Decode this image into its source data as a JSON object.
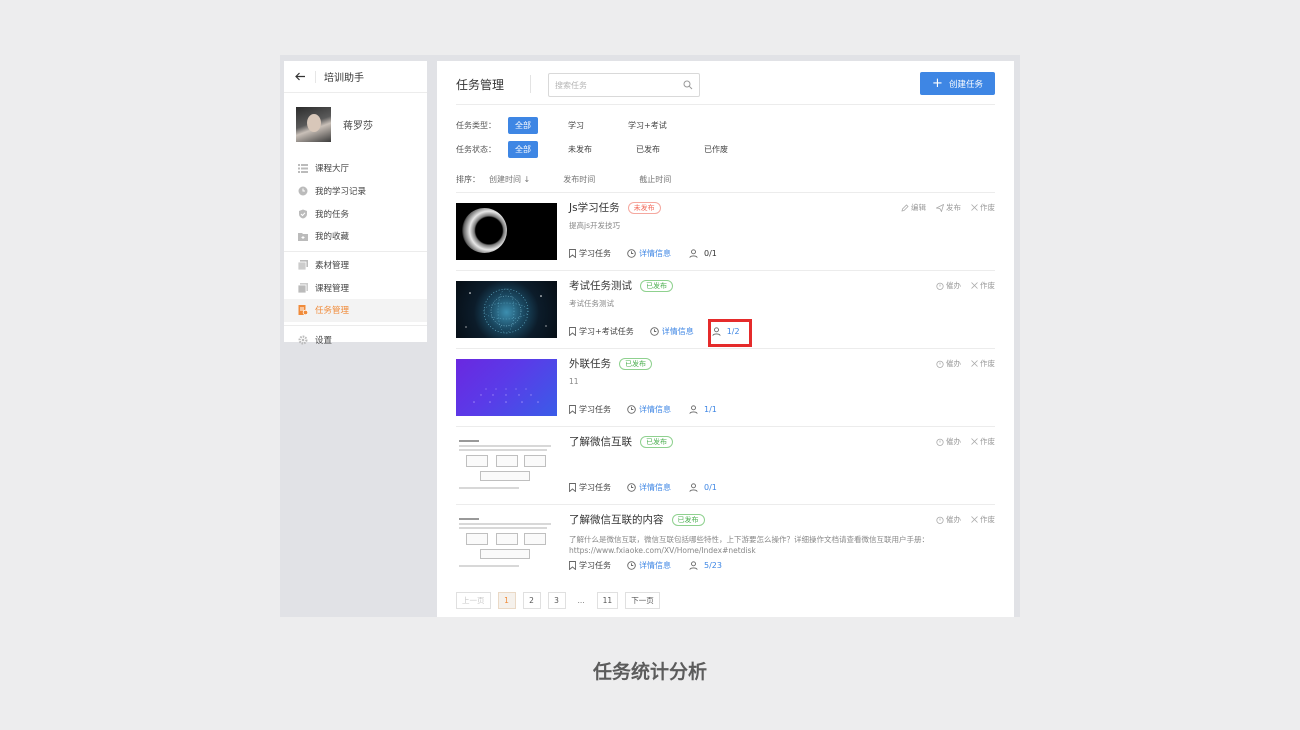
{
  "sidebar": {
    "app_title": "培训助手",
    "user_name": "蒋罗莎",
    "groups": [
      [
        {
          "label": "课程大厅",
          "icon": "list-icon"
        },
        {
          "label": "我的学习记录",
          "icon": "clock-icon"
        },
        {
          "label": "我的任务",
          "icon": "shield-check-icon"
        },
        {
          "label": "我的收藏",
          "icon": "folder-icon"
        }
      ],
      [
        {
          "label": "素材管理",
          "icon": "images-icon"
        },
        {
          "label": "课程管理",
          "icon": "pages-icon"
        },
        {
          "label": "任务管理",
          "icon": "task-doc-icon",
          "active": true
        }
      ],
      [
        {
          "label": "设置",
          "icon": "gear-icon"
        }
      ]
    ]
  },
  "header": {
    "title": "任务管理",
    "search_placeholder": "搜索任务",
    "create_label": "创建任务"
  },
  "filters": {
    "type_label": "任务类型：",
    "type_options": [
      "全部",
      "学习",
      "学习+考试"
    ],
    "type_selected": "全部",
    "status_label": "任务状态：",
    "status_options": [
      "全部",
      "未发布",
      "已发布",
      "已作废"
    ],
    "status_selected": "全部"
  },
  "sort": {
    "label": "排序：",
    "options": [
      "创建时间",
      "发布时间",
      "截止时间"
    ],
    "active": "创建时间"
  },
  "tasks": [
    {
      "name": "Js学习任务",
      "status": "未发布",
      "desc": "提高js开发技巧",
      "type": "学习任务",
      "detail": "详情信息",
      "count": "0/1",
      "actions": [
        "编辑",
        "发布",
        "作废"
      ]
    },
    {
      "name": "考试任务测试",
      "status": "已发布",
      "desc": "考试任务测试",
      "type": "学习+考试任务",
      "detail": "详情信息",
      "count": "1/2",
      "actions": [
        "催办",
        "作废"
      ]
    },
    {
      "name": "外联任务",
      "status": "已发布",
      "desc": "11",
      "type": "学习任务",
      "detail": "详情信息",
      "count": "1/1",
      "actions": [
        "催办",
        "作废"
      ]
    },
    {
      "name": "了解微信互联",
      "status": "已发布",
      "desc": "",
      "type": "学习任务",
      "detail": "详情信息",
      "count": "0/1",
      "actions": [
        "催办",
        "作废"
      ]
    },
    {
      "name": "了解微信互联的内容",
      "status": "已发布",
      "desc": "了解什么是微信互联，微信互联包括哪些特性，上下游要怎么操作？详细操作文档请查看微信互联用户手册：https://www.fxiaoke.com/XV/Home/Index#netdisk",
      "type": "学习任务",
      "detail": "详情信息",
      "count": "5/23",
      "actions": [
        "催办",
        "作废"
      ]
    }
  ],
  "pagination": {
    "prev": "上一页",
    "pages": [
      "1",
      "2",
      "3"
    ],
    "ellipsis": "...",
    "last": "11",
    "next": "下一页",
    "current": "1"
  },
  "caption": "任务统计分析",
  "colors": {
    "accent": "#3e86e4",
    "active_menu": "#f08b3a",
    "unpublished": "#f26b5b",
    "published": "#4caf50",
    "highlight": "#e52b2b"
  }
}
